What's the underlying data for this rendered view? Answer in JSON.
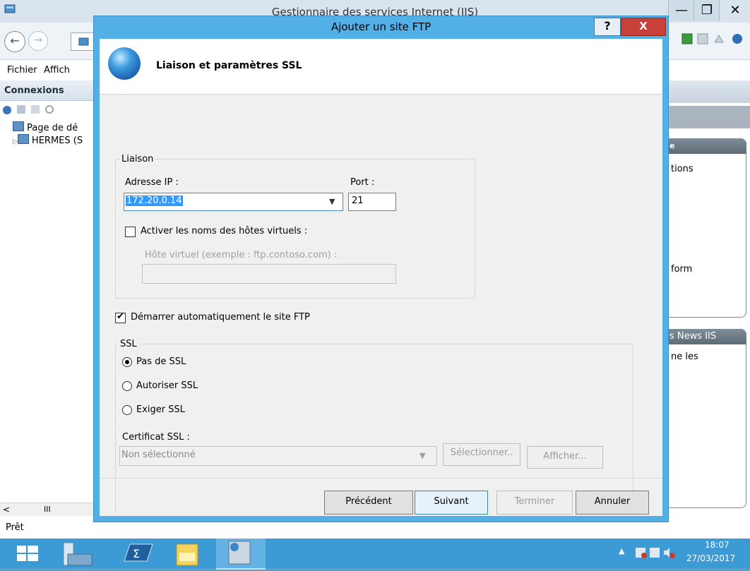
{
  "background_window": {
    "title": "Gestionnaire des services Internet (IIS)",
    "controls": {
      "minimize": "—",
      "maximize": "❐",
      "close": "✕"
    },
    "menu": {
      "file": "Fichier",
      "view": "Affich"
    },
    "connections": {
      "title": "Connexions",
      "tree": [
        "Page de dé",
        "HERMES (S"
      ]
    },
    "scroll": {
      "left": "<",
      "middle": "III"
    },
    "right_panel": {
      "panel1_header": "e",
      "panel1_text1": "tions",
      "panel1_text2": "form",
      "panel2_header": "s News IIS",
      "panel2_text1": "ne les"
    },
    "status": "Prêt"
  },
  "dialog": {
    "title": "Ajouter un site FTP",
    "help_button": "?",
    "close_button": "X",
    "heading": "Liaison et paramètres SSL",
    "binding": {
      "group_label": "Liaison",
      "ip_label": "Adresse IP :",
      "ip_value": "172.20.0.14",
      "port_label": "Port :",
      "port_value": "21",
      "vhost_checkbox_label": "Activer les noms des hôtes virtuels :",
      "vhost_hint": "Hôte virtuel (exemple : ftp.contoso.com) :",
      "vhost_value": ""
    },
    "autostart": {
      "label": "Démarrer automatiquement le site FTP",
      "checked": true
    },
    "ssl": {
      "group_label": "SSL",
      "options": [
        "Pas de SSL",
        "Autoriser SSL",
        "Exiger SSL"
      ],
      "selected": "Pas de SSL",
      "cert_label": "Certificat SSL :",
      "cert_value": "Non sélectionné",
      "select_button": "Sélectionner..",
      "show_button": "Afficher..."
    },
    "buttons": {
      "previous": "Précédent",
      "next": "Suivant",
      "finish": "Terminer",
      "cancel": "Annuler"
    }
  },
  "taskbar": {
    "time": "18:07",
    "date": "27/03/2017",
    "tray_arrow": "▲"
  }
}
